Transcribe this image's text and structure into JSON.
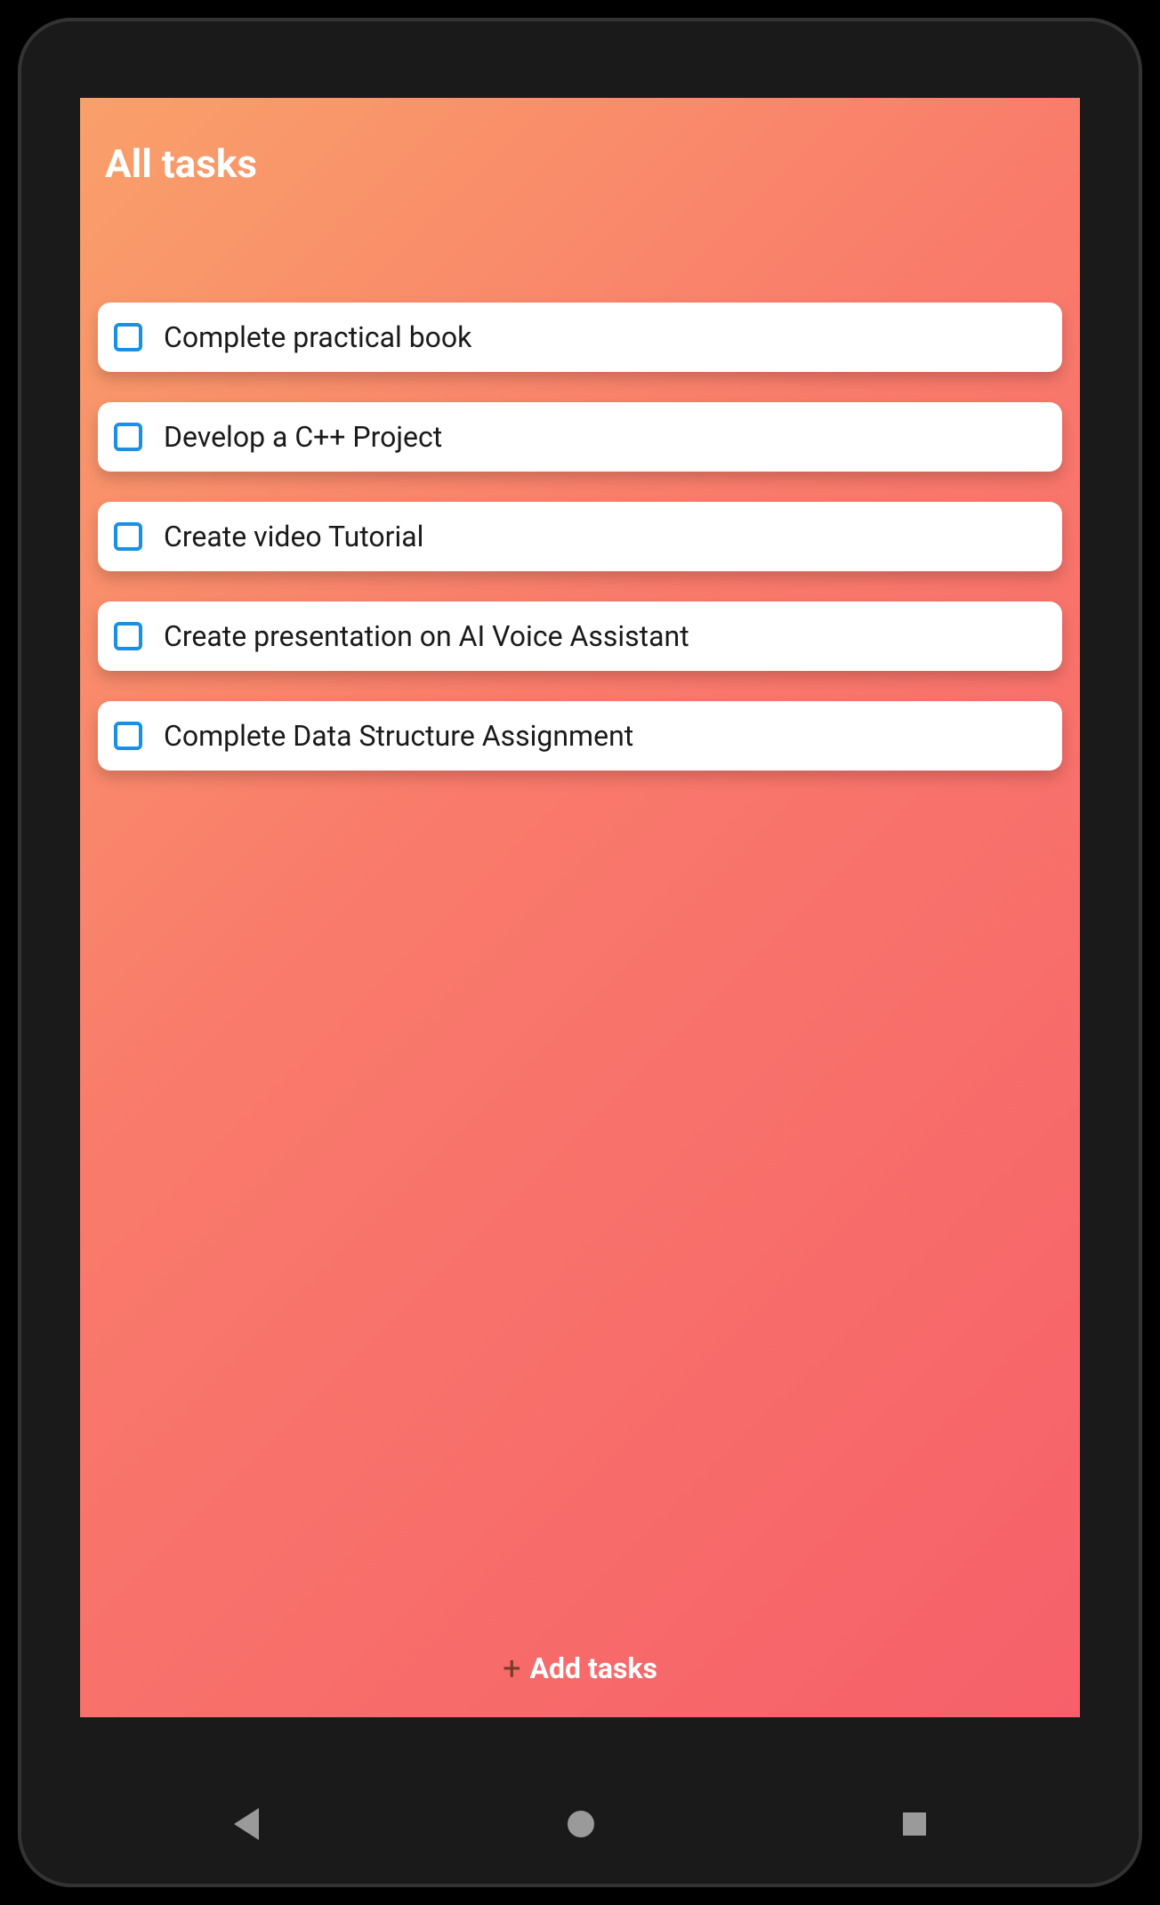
{
  "header": {
    "title": "All tasks"
  },
  "tasks": [
    {
      "label": "Complete practical book",
      "checked": false
    },
    {
      "label": "Develop a C++ Project",
      "checked": false
    },
    {
      "label": "Create video Tutorial",
      "checked": false
    },
    {
      "label": "Create presentation on AI Voice Assistant",
      "checked": false
    },
    {
      "label": "Complete Data Structure Assignment",
      "checked": false
    }
  ],
  "footer": {
    "add_label": "Add tasks",
    "plus_glyph": "+"
  }
}
